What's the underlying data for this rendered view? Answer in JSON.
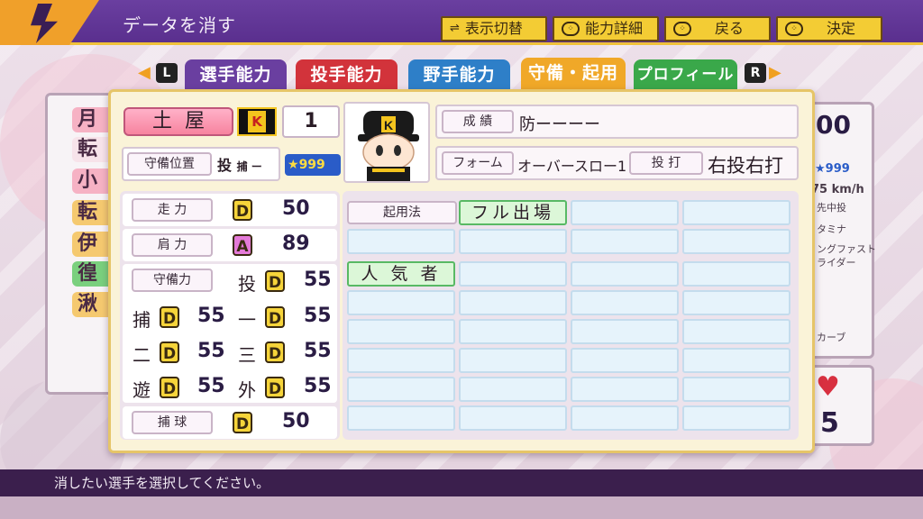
{
  "header": {
    "title": "データを消す",
    "buttons": [
      {
        "label": "表示切替"
      },
      {
        "label": "能力詳細"
      },
      {
        "label": "戻る"
      },
      {
        "label": "決定"
      }
    ]
  },
  "tabs": {
    "left_key": "L",
    "right_key": "R",
    "items": [
      {
        "label": "選手能力",
        "color": "#6a3fa0"
      },
      {
        "label": "投手能力",
        "color": "#d2333b"
      },
      {
        "label": "野手能力",
        "color": "#2e7fc8"
      },
      {
        "label": "守備・起用",
        "color": "#f0a828",
        "active": true
      },
      {
        "label": "プロフィール",
        "color": "#3aa84a"
      }
    ]
  },
  "player": {
    "name": "土屋",
    "team_logo": "K",
    "number": "1",
    "position_label": "守備位置",
    "position_main": "投",
    "position_sub": "捕 ー",
    "star_rating": "999"
  },
  "info": {
    "record_label": "成 績",
    "record_value": "防ーーーー",
    "form_label": "フォーム",
    "form_value": "オーバースロー1",
    "bats_label": "投 打",
    "bats_value": "右投右打"
  },
  "stats": {
    "speed_label": "走 力",
    "speed_grade": "D",
    "speed_value": "50",
    "arm_label": "肩 力",
    "arm_grade": "A",
    "arm_value": "89",
    "fielding_label": "守備力",
    "catching_label": "捕 球",
    "catching_grade": "D",
    "catching_value": "50",
    "positions": [
      {
        "pos": "投",
        "grade": "D",
        "value": "55"
      },
      {
        "pos": "捕",
        "grade": "D",
        "value": "55"
      },
      {
        "pos": "一",
        "grade": "D",
        "value": "55"
      },
      {
        "pos": "二",
        "grade": "D",
        "value": "55"
      },
      {
        "pos": "三",
        "grade": "D",
        "value": "55"
      },
      {
        "pos": "遊",
        "grade": "D",
        "value": "55"
      },
      {
        "pos": "外",
        "grade": "D",
        "value": "55"
      }
    ]
  },
  "usage": {
    "label": "起用法",
    "usage_value": "フル出場",
    "trait_value": "人 気 者"
  },
  "background": {
    "right_value": "00",
    "right_star": "999",
    "right_speed": "75 km/h",
    "right_pos": "先中投",
    "right_stamina": "タミナ",
    "right_pitch1": "ングファスト",
    "right_pitch2": "ライダー",
    "right_pitch3": "カーブ",
    "right_heart_num": "5",
    "left_tags": [
      "月",
      "転",
      "小",
      "転",
      "伊",
      "徨",
      "湫"
    ]
  },
  "footer": {
    "message": "消したい選手を選択してください。"
  }
}
